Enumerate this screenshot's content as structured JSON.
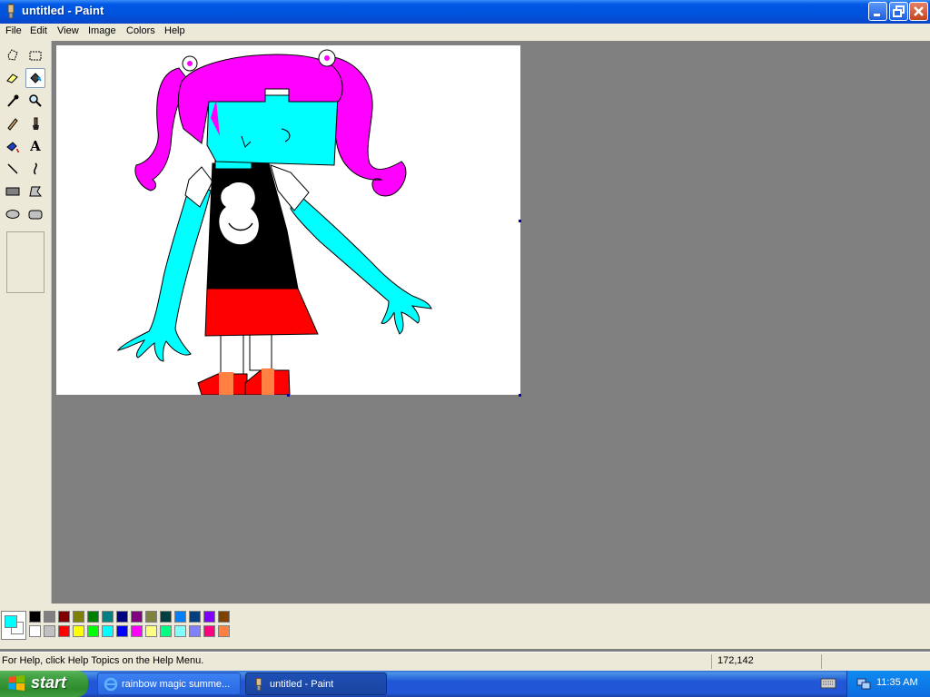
{
  "window": {
    "title": "untitled - Paint",
    "buttons": [
      "minimize",
      "maximize",
      "close"
    ]
  },
  "menubar": {
    "items": [
      "File",
      "Edit",
      "View",
      "Image",
      "Colors",
      "Help"
    ]
  },
  "toolbox": {
    "tools": [
      {
        "name": "free-form-select",
        "selected": false
      },
      {
        "name": "select",
        "selected": false
      },
      {
        "name": "eraser",
        "selected": false
      },
      {
        "name": "fill-with-color",
        "selected": true
      },
      {
        "name": "pick-color",
        "selected": false
      },
      {
        "name": "magnifier",
        "selected": false
      },
      {
        "name": "pencil",
        "selected": false
      },
      {
        "name": "brush",
        "selected": false
      },
      {
        "name": "airbrush",
        "selected": false
      },
      {
        "name": "text",
        "selected": false
      },
      {
        "name": "line",
        "selected": false
      },
      {
        "name": "curve",
        "selected": false
      },
      {
        "name": "rectangle",
        "selected": false
      },
      {
        "name": "polygon",
        "selected": false
      },
      {
        "name": "ellipse",
        "selected": false
      },
      {
        "name": "rounded-rectangle",
        "selected": false
      }
    ],
    "text_tool_glyph": "A"
  },
  "palette": {
    "foreground": "#00ffff",
    "background": "#ffffff",
    "row1": [
      "#000000",
      "#808080",
      "#800000",
      "#808000",
      "#008000",
      "#008080",
      "#000080",
      "#800080",
      "#808040",
      "#004040",
      "#0080ff",
      "#004080",
      "#8000ff",
      "#804000"
    ],
    "row2": [
      "#ffffff",
      "#c0c0c0",
      "#ff0000",
      "#ffff00",
      "#00ff00",
      "#00ffff",
      "#0000ff",
      "#ff00ff",
      "#ffff80",
      "#00ff80",
      "#80ffff",
      "#8080ff",
      "#ff0080",
      "#ff8040"
    ]
  },
  "statusbar": {
    "help_text": "For Help, click Help Topics on the Help Menu.",
    "coordinates": "172,142",
    "size": ""
  },
  "taskbar": {
    "start_label": "start",
    "tasks": [
      {
        "label": "rainbow magic summe...",
        "icon": "ie-icon",
        "active": false
      },
      {
        "label": "untitled - Paint",
        "icon": "paint-icon",
        "active": true
      }
    ],
    "clock": "11:35 AM"
  },
  "drawing_colors": {
    "skin": "#00ffff",
    "hair": "#ff00ff",
    "dress": "#000000",
    "skirt": "#ff0000",
    "socks": "#ff8040"
  }
}
